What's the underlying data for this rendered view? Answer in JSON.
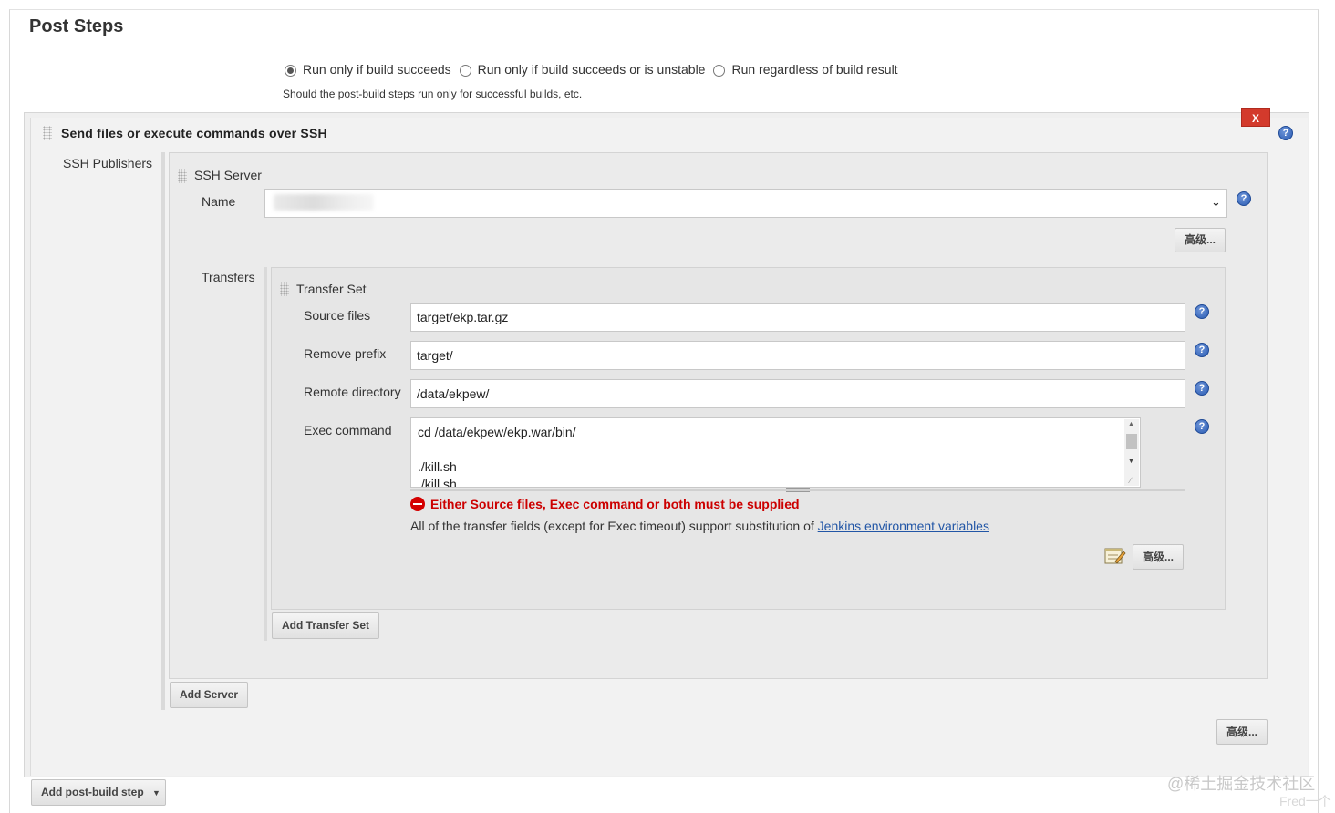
{
  "page": {
    "title": "Post Steps"
  },
  "run_condition": {
    "options": [
      {
        "label": "Run only if build succeeds",
        "selected": true
      },
      {
        "label": "Run only if build succeeds or is unstable",
        "selected": false
      },
      {
        "label": "Run regardless of build result",
        "selected": false
      }
    ],
    "description": "Should the post-build steps run only for successful builds, etc."
  },
  "ssh_step": {
    "title": "Send files or execute commands over SSH",
    "delete_label": "X",
    "publishers_label": "SSH Publishers",
    "server": {
      "title": "SSH Server",
      "name_label": "Name",
      "advanced_label": "高级..."
    },
    "transfers": {
      "label": "Transfers",
      "set_title": "Transfer Set",
      "fields": {
        "source_files": {
          "label": "Source files",
          "value": "target/ekp.tar.gz"
        },
        "remove_prefix": {
          "label": "Remove prefix",
          "value": "target/"
        },
        "remote_directory": {
          "label": "Remote directory",
          "value": "/data/ekpew/"
        },
        "exec_command": {
          "label": "Exec command",
          "value": "cd /data/ekpew/ekp.war/bin/\n\n./kill.sh\n./kill.sh"
        }
      },
      "error_text": "Either Source files, Exec command or both must be supplied",
      "note_text": "All of the transfer fields (except for Exec timeout) support substitution of ",
      "note_link": "Jenkins environment variables",
      "advanced_label": "高级...",
      "add_transfer_set_label": "Add Transfer Set"
    },
    "add_server_label": "Add Server",
    "advanced_label": "高级..."
  },
  "add_post_build_step_label": "Add post-build step",
  "watermark": {
    "line1": "@稀土掘金技术社区",
    "line2": "Fred一个"
  },
  "colors": {
    "delete": "#d33a2c",
    "error": "#cc0000",
    "link": "#2256a6",
    "help": "#2b5cb3"
  }
}
